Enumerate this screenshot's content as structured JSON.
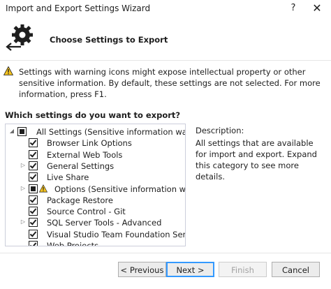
{
  "window": {
    "title": "Import and Export Settings Wizard",
    "help_glyph": "?",
    "close_glyph": "✕"
  },
  "header": {
    "title": "Choose Settings to Export",
    "icon": "export-settings-gear-icon"
  },
  "warning_banner": {
    "icon": "warning-icon",
    "text": "Settings with warning icons might expose intellectual property or other sensitive information. By default, these settings are not selected. For more information, press F1."
  },
  "question": "Which settings do you want to export?",
  "tree": {
    "items": [
      {
        "label": "All Settings (Sensitive information warning)",
        "state": "partial",
        "expander": "◢",
        "warning": false,
        "level": 0
      },
      {
        "label": "Browser Link Options",
        "state": "checked",
        "expander": "",
        "warning": false,
        "level": 1
      },
      {
        "label": "External Web Tools",
        "state": "checked",
        "expander": "",
        "warning": false,
        "level": 1
      },
      {
        "label": "General Settings",
        "state": "checked",
        "expander": "▷",
        "warning": false,
        "level": 1
      },
      {
        "label": "Live Share",
        "state": "checked",
        "expander": "",
        "warning": false,
        "level": 1
      },
      {
        "label": "Options (Sensitive information warning)",
        "state": "partial",
        "expander": "▷",
        "warning": true,
        "level": 1
      },
      {
        "label": "Package Restore",
        "state": "checked",
        "expander": "",
        "warning": false,
        "level": 1
      },
      {
        "label": "Source Control - Git",
        "state": "checked",
        "expander": "",
        "warning": false,
        "level": 1
      },
      {
        "label": "SQL Server Tools - Advanced",
        "state": "checked",
        "expander": "▷",
        "warning": false,
        "level": 1
      },
      {
        "label": "Visual Studio Team Foundation Server",
        "state": "checked",
        "expander": "",
        "warning": false,
        "level": 1
      },
      {
        "label": "Web Projects",
        "state": "checked",
        "expander": "",
        "warning": false,
        "level": 1
      }
    ]
  },
  "description": {
    "title": "Description:",
    "text": "All settings that are available for import and export. Expand this category to see more details."
  },
  "buttons": {
    "previous": "< Previous",
    "next": "Next >",
    "finish": "Finish",
    "cancel": "Cancel"
  },
  "colors": {
    "warning_yellow": "#f7c41f",
    "focus_blue": "#3399ff"
  }
}
